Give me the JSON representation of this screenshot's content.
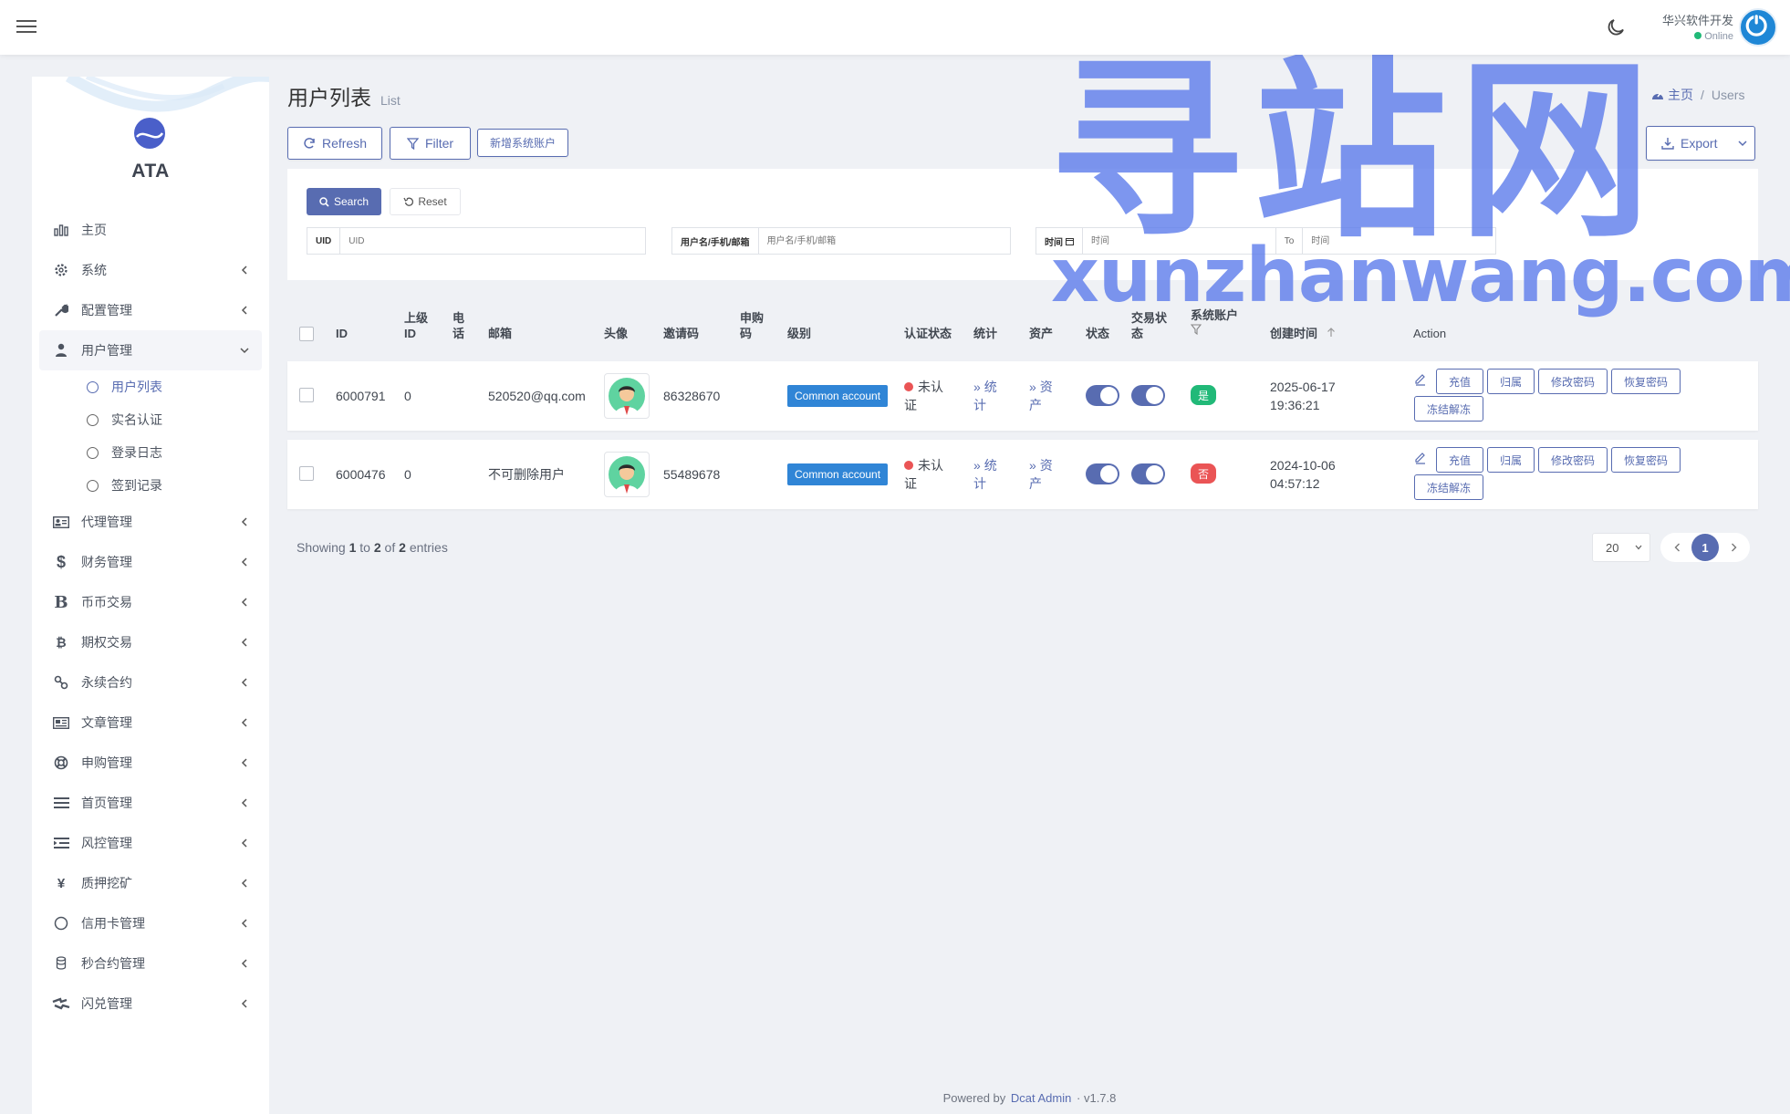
{
  "header": {
    "username": "华兴软件开发",
    "status": "Online"
  },
  "sidebar": {
    "brand": "ATA",
    "items": [
      {
        "label": "主页",
        "icon": "bar-chart-icon"
      },
      {
        "label": "系统",
        "icon": "gear-icon"
      },
      {
        "label": "配置管理",
        "icon": "wrench-icon"
      },
      {
        "label": "用户管理",
        "icon": "user-tie-icon"
      },
      {
        "label": "代理管理",
        "icon": "id-card-icon"
      },
      {
        "label": "财务管理",
        "icon": "dollar-icon"
      },
      {
        "label": "币币交易",
        "icon": "b-letter-icon"
      },
      {
        "label": "期权交易",
        "icon": "bitcoin-icon"
      },
      {
        "label": "永续合约",
        "icon": "link-icon"
      },
      {
        "label": "文章管理",
        "icon": "newspaper-icon"
      },
      {
        "label": "申购管理",
        "icon": "life-ring-icon"
      },
      {
        "label": "首页管理",
        "icon": "list-icon"
      },
      {
        "label": "风控管理",
        "icon": "indent-icon"
      },
      {
        "label": "质押挖矿",
        "icon": "yen-icon"
      },
      {
        "label": "信用卡管理",
        "icon": "circle-icon"
      },
      {
        "label": "秒合约管理",
        "icon": "coins-icon"
      },
      {
        "label": "闪兑管理",
        "icon": "exchange-icon"
      }
    ],
    "user_submenu": [
      "用户列表",
      "实名认证",
      "登录日志",
      "签到记录"
    ]
  },
  "page": {
    "title": "用户列表",
    "subtitle": "List"
  },
  "breadcrumb": {
    "home": "主页",
    "current": "Users"
  },
  "toolbar": {
    "refresh": "Refresh",
    "filter": "Filter",
    "add_system": "新增系统账户",
    "export": "Export"
  },
  "filter": {
    "search": "Search",
    "reset": "Reset",
    "uid_label": "UID",
    "uid_placeholder": "UID",
    "user_label": "用户名/手机/邮箱",
    "user_placeholder": "用户名/手机/邮箱",
    "time_label": "时间",
    "time_start_placeholder": "时间",
    "time_to": "To",
    "time_end_placeholder": "时间"
  },
  "table": {
    "columns": {
      "id": "ID",
      "parent_a": "上级",
      "parent_b": "ID",
      "phone_a": "电",
      "phone_b": "话",
      "email": "邮箱",
      "avatar": "头像",
      "invite": "邀请码",
      "sub_a": "申购",
      "sub_b": "码",
      "level": "级别",
      "verify": "认证状态",
      "stats": "统计",
      "assets": "资产",
      "status": "状态",
      "trade_a": "交易状",
      "trade_b": "态",
      "system": "系统账户",
      "created": "创建时间",
      "action": "Action"
    },
    "rows": [
      {
        "id": "6000791",
        "parent": "0",
        "email": "520520@qq.com",
        "invite": "86328670",
        "level": "Common account",
        "verify_a": "未认",
        "verify_b": "证",
        "stats_a": "统",
        "stats_b": "计",
        "assets_a": "资",
        "assets_b": "产",
        "system": "是",
        "date": "2025-06-17",
        "time": "19:36:21"
      },
      {
        "id": "6000476",
        "parent": "0",
        "email": "不可删除用户",
        "invite": "55489678",
        "level": "Common account",
        "verify_a": "未认",
        "verify_b": "证",
        "stats_a": "统",
        "stats_b": "计",
        "assets_a": "资",
        "assets_b": "产",
        "system": "否",
        "date": "2024-10-06",
        "time": "04:57:12"
      }
    ],
    "actions": {
      "recharge": "充值",
      "belong": "归属",
      "change_pwd": "修改密码",
      "reset_pwd": "恢复密码",
      "freeze": "冻结解冻"
    }
  },
  "pagination": {
    "showing_pre": "Showing",
    "from": "1",
    "to_word": "to",
    "to": "2",
    "of_word": "of",
    "total": "2",
    "entries": "entries",
    "per_page": "20",
    "current": "1"
  },
  "footer": {
    "powered": "Powered by",
    "brand": "Dcat Admin",
    "sep": "·",
    "version": "v1.7.8"
  },
  "watermark": {
    "cn": "寻站网",
    "en": "xunzhanwang.com"
  },
  "colors": {
    "primary": "#586cb1",
    "badge_blue": "#3085d6",
    "success": "#21b978",
    "danger": "#ea5455"
  }
}
